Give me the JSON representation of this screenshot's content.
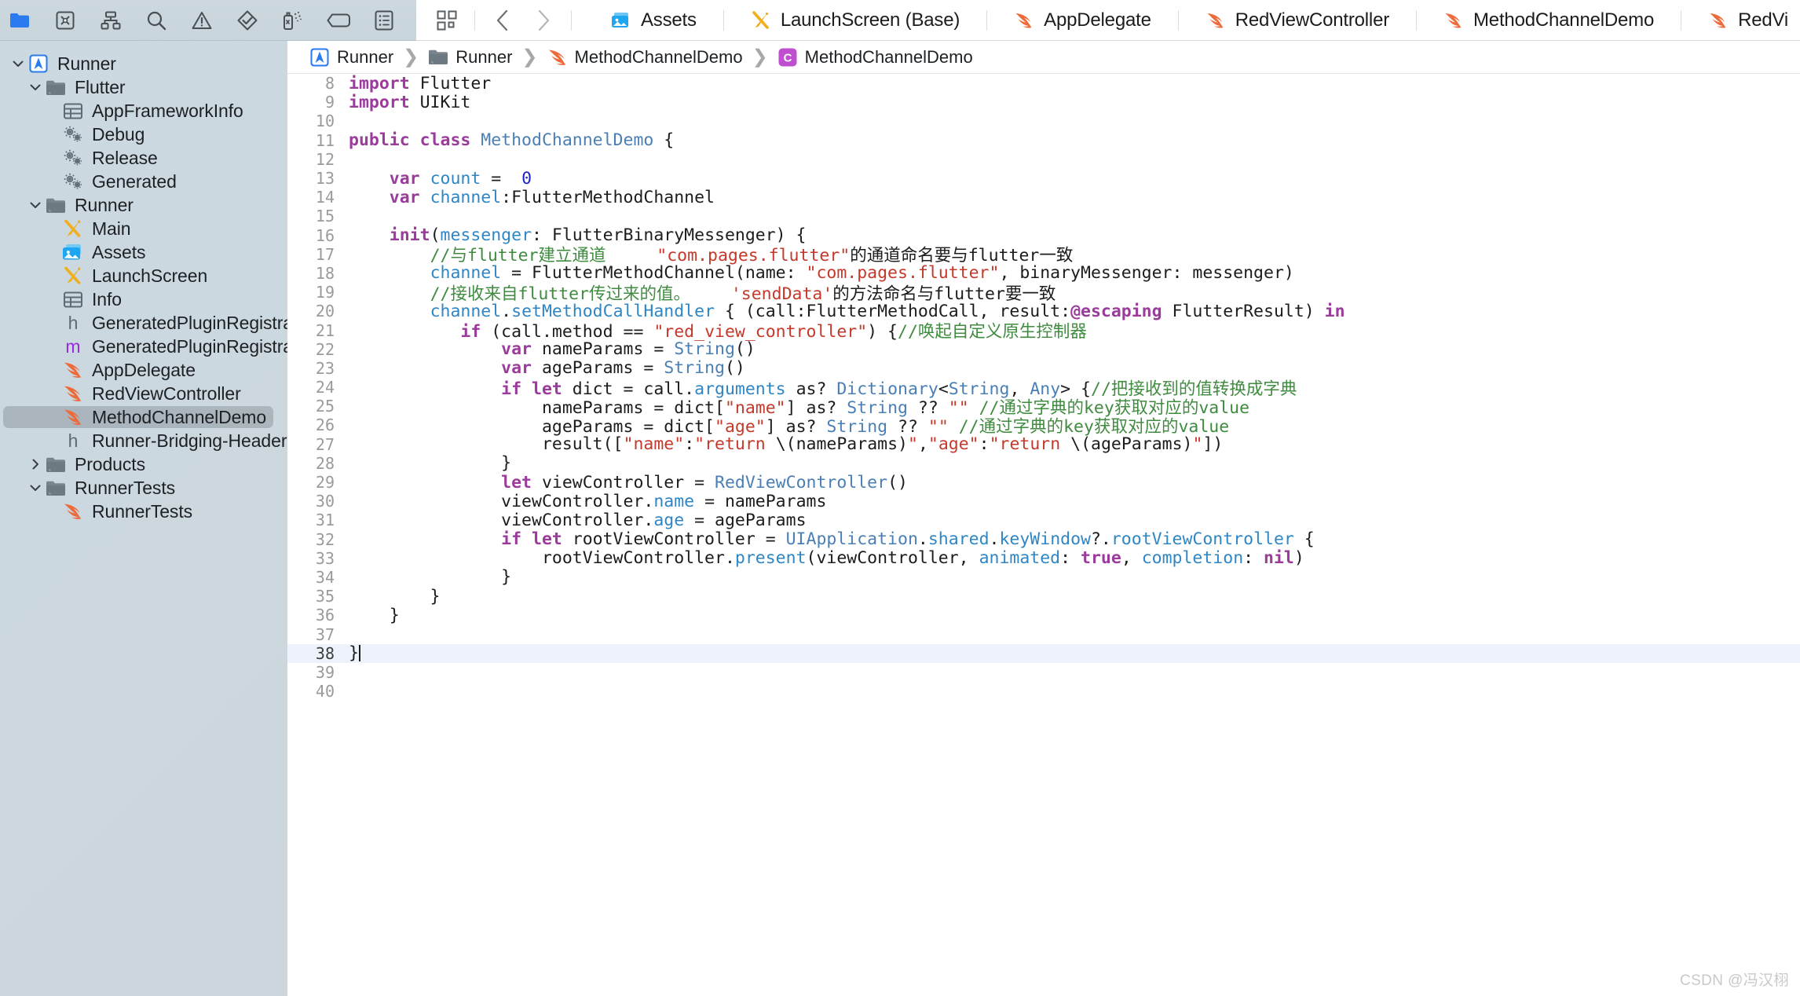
{
  "navigator_toolbar": {
    "icons": [
      {
        "name": "folder-icon",
        "label": "Project navigator"
      },
      {
        "name": "source-control-icon",
        "label": "Source control navigator"
      },
      {
        "name": "symbol-hierarchy-icon",
        "label": "Symbol navigator"
      },
      {
        "name": "search-icon",
        "label": "Find navigator"
      },
      {
        "name": "warning-triangle-icon",
        "label": "Issue navigator"
      },
      {
        "name": "test-diamond-icon",
        "label": "Test navigator"
      },
      {
        "name": "debug-spray-icon",
        "label": "Debug navigator"
      },
      {
        "name": "breakpoint-tag-icon",
        "label": "Breakpoint navigator"
      },
      {
        "name": "report-list-icon",
        "label": "Report navigator"
      }
    ]
  },
  "tabbar": {
    "grid_button": "tab-overview",
    "back_button": "back",
    "forward_button": "forward",
    "tabs": [
      {
        "label": "Assets",
        "icon": "assets-icon",
        "active": false
      },
      {
        "label": "LaunchScreen (Base)",
        "icon": "storyboard-icon",
        "active": false
      },
      {
        "label": "AppDelegate",
        "icon": "swift-icon",
        "active": false
      },
      {
        "label": "RedViewController",
        "icon": "swift-icon",
        "active": false
      },
      {
        "label": "MethodChannelDemo",
        "icon": "swift-icon",
        "active": true
      },
      {
        "label": "RedVi",
        "icon": "swift-icon",
        "active": false
      }
    ]
  },
  "sidebar": {
    "items": [
      {
        "label": "Runner",
        "indent": 0,
        "twisty": "down",
        "icon": "xcode-project-icon",
        "selected": false
      },
      {
        "label": "Flutter",
        "indent": 1,
        "twisty": "down",
        "icon": "folder-icon",
        "selected": false
      },
      {
        "label": "AppFrameworkInfo",
        "indent": 2,
        "twisty": "none",
        "icon": "plist-icon",
        "selected": false
      },
      {
        "label": "Debug",
        "indent": 2,
        "twisty": "none",
        "icon": "gears-icon",
        "selected": false
      },
      {
        "label": "Release",
        "indent": 2,
        "twisty": "none",
        "icon": "gears-icon",
        "selected": false
      },
      {
        "label": "Generated",
        "indent": 2,
        "twisty": "none",
        "icon": "gears-icon",
        "selected": false
      },
      {
        "label": "Runner",
        "indent": 1,
        "twisty": "down",
        "icon": "folder-icon",
        "selected": false
      },
      {
        "label": "Main",
        "indent": 2,
        "twisty": "none",
        "icon": "storyboard-icon",
        "selected": false
      },
      {
        "label": "Assets",
        "indent": 2,
        "twisty": "none",
        "icon": "assets-icon",
        "selected": false
      },
      {
        "label": "LaunchScreen",
        "indent": 2,
        "twisty": "none",
        "icon": "storyboard-icon",
        "selected": false
      },
      {
        "label": "Info",
        "indent": 2,
        "twisty": "none",
        "icon": "plist-icon",
        "selected": false
      },
      {
        "label": "GeneratedPluginRegistrant",
        "indent": 2,
        "twisty": "none",
        "icon": "header-h-icon",
        "selected": false
      },
      {
        "label": "GeneratedPluginRegistrant",
        "indent": 2,
        "twisty": "none",
        "icon": "objc-m-icon",
        "selected": false
      },
      {
        "label": "AppDelegate",
        "indent": 2,
        "twisty": "none",
        "icon": "swift-icon",
        "selected": false
      },
      {
        "label": "RedViewController",
        "indent": 2,
        "twisty": "none",
        "icon": "swift-icon",
        "selected": false
      },
      {
        "label": "MethodChannelDemo",
        "indent": 2,
        "twisty": "none",
        "icon": "swift-icon",
        "selected": true
      },
      {
        "label": "Runner-Bridging-Header",
        "indent": 2,
        "twisty": "none",
        "icon": "header-h-icon",
        "selected": false
      },
      {
        "label": "Products",
        "indent": 1,
        "twisty": "right",
        "icon": "folder-icon",
        "selected": false
      },
      {
        "label": "RunnerTests",
        "indent": 1,
        "twisty": "down",
        "icon": "folder-icon",
        "selected": false
      },
      {
        "label": "RunnerTests",
        "indent": 2,
        "twisty": "none",
        "icon": "swift-icon",
        "selected": false
      }
    ]
  },
  "breadcrumb": {
    "crumbs": [
      {
        "label": "Runner",
        "icon": "xcode-project-icon"
      },
      {
        "label": "Runner",
        "icon": "folder-icon"
      },
      {
        "label": "MethodChannelDemo",
        "icon": "swift-icon"
      },
      {
        "label": "MethodChannelDemo",
        "icon": "class-c-icon"
      }
    ],
    "separator": "❯"
  },
  "editor": {
    "first_line": 8,
    "current_line": 38,
    "lines": [
      {
        "n": 8,
        "tokens": [
          {
            "t": "import",
            "c": "kw"
          },
          {
            "t": " Flutter",
            "c": "plain"
          }
        ]
      },
      {
        "n": 9,
        "tokens": [
          {
            "t": "import",
            "c": "kw"
          },
          {
            "t": " UIKit",
            "c": "plain"
          }
        ]
      },
      {
        "n": 10,
        "tokens": []
      },
      {
        "n": 11,
        "tokens": [
          {
            "t": "public ",
            "c": "kw"
          },
          {
            "t": "class ",
            "c": "kw"
          },
          {
            "t": "MethodChannelDemo",
            "c": "ty"
          },
          {
            "t": " {",
            "c": "plain"
          }
        ]
      },
      {
        "n": 12,
        "tokens": []
      },
      {
        "n": 13,
        "tokens": [
          {
            "t": "    ",
            "c": "plain"
          },
          {
            "t": "var ",
            "c": "kw"
          },
          {
            "t": "count",
            "c": "id"
          },
          {
            "t": " =  ",
            "c": "plain"
          },
          {
            "t": "0",
            "c": "num"
          }
        ]
      },
      {
        "n": 14,
        "tokens": [
          {
            "t": "    ",
            "c": "plain"
          },
          {
            "t": "var ",
            "c": "kw"
          },
          {
            "t": "channel",
            "c": "id"
          },
          {
            "t": ":FlutterMethodChannel",
            "c": "plain"
          }
        ]
      },
      {
        "n": 15,
        "tokens": []
      },
      {
        "n": 16,
        "tokens": [
          {
            "t": "    ",
            "c": "plain"
          },
          {
            "t": "init",
            "c": "kw"
          },
          {
            "t": "(",
            "c": "plain"
          },
          {
            "t": "messenger",
            "c": "id"
          },
          {
            "t": ": FlutterBinaryMessenger) {",
            "c": "plain"
          }
        ]
      },
      {
        "n": 17,
        "tokens": [
          {
            "t": "        ",
            "c": "plain"
          },
          {
            "t": "//与flutter建立通道     ",
            "c": "cmt"
          },
          {
            "t": "\"com.pages.flutter\"",
            "c": "str"
          },
          {
            "t": "的通道命名要与flutter一致",
            "c": "plain"
          }
        ]
      },
      {
        "n": 18,
        "tokens": [
          {
            "t": "        ",
            "c": "plain"
          },
          {
            "t": "channel",
            "c": "id"
          },
          {
            "t": " = FlutterMethodChannel(name: ",
            "c": "plain"
          },
          {
            "t": "\"com.pages.flutter\"",
            "c": "str"
          },
          {
            "t": ", binaryMessenger: messenger)",
            "c": "plain"
          }
        ]
      },
      {
        "n": 19,
        "tokens": [
          {
            "t": "        ",
            "c": "plain"
          },
          {
            "t": "//接收来自flutter传过来的值。    ",
            "c": "cmt"
          },
          {
            "t": "'sendData'",
            "c": "str"
          },
          {
            "t": "的方法命名与flutter要一致",
            "c": "plain"
          }
        ]
      },
      {
        "n": 20,
        "tokens": [
          {
            "t": "        ",
            "c": "plain"
          },
          {
            "t": "channel",
            "c": "id"
          },
          {
            "t": ".",
            "c": "plain"
          },
          {
            "t": "setMethodCallHandler",
            "c": "prop"
          },
          {
            "t": " { (call:FlutterMethodCall, result:",
            "c": "plain"
          },
          {
            "t": "@escaping",
            "c": "attr"
          },
          {
            "t": " FlutterResult) ",
            "c": "plain"
          },
          {
            "t": "in",
            "c": "kw"
          }
        ]
      },
      {
        "n": 21,
        "tokens": [
          {
            "t": "           ",
            "c": "plain"
          },
          {
            "t": "if",
            "c": "kw"
          },
          {
            "t": " (call.method == ",
            "c": "plain"
          },
          {
            "t": "\"red_view_controller\"",
            "c": "str"
          },
          {
            "t": ") {",
            "c": "plain"
          },
          {
            "t": "//唤起自定义原生控制器",
            "c": "cmt"
          }
        ]
      },
      {
        "n": 22,
        "tokens": [
          {
            "t": "               ",
            "c": "plain"
          },
          {
            "t": "var ",
            "c": "kw"
          },
          {
            "t": "nameParams = ",
            "c": "plain"
          },
          {
            "t": "String",
            "c": "ty"
          },
          {
            "t": "()",
            "c": "plain"
          }
        ]
      },
      {
        "n": 23,
        "tokens": [
          {
            "t": "               ",
            "c": "plain"
          },
          {
            "t": "var ",
            "c": "kw"
          },
          {
            "t": "ageParams = ",
            "c": "plain"
          },
          {
            "t": "String",
            "c": "ty"
          },
          {
            "t": "()",
            "c": "plain"
          }
        ]
      },
      {
        "n": 24,
        "tokens": [
          {
            "t": "               ",
            "c": "plain"
          },
          {
            "t": "if let ",
            "c": "kw"
          },
          {
            "t": "dict = call.",
            "c": "plain"
          },
          {
            "t": "arguments",
            "c": "prop"
          },
          {
            "t": " as? ",
            "c": "plain"
          },
          {
            "t": "Dictionary",
            "c": "ty"
          },
          {
            "t": "<",
            "c": "plain"
          },
          {
            "t": "String",
            "c": "ty"
          },
          {
            "t": ", ",
            "c": "plain"
          },
          {
            "t": "Any",
            "c": "ty"
          },
          {
            "t": "> {",
            "c": "plain"
          },
          {
            "t": "//把接收到的值转换成字典",
            "c": "cmt"
          }
        ]
      },
      {
        "n": 25,
        "tokens": [
          {
            "t": "                   ",
            "c": "plain"
          },
          {
            "t": "nameParams = dict[",
            "c": "plain"
          },
          {
            "t": "\"name\"",
            "c": "str"
          },
          {
            "t": "] as? ",
            "c": "plain"
          },
          {
            "t": "String",
            "c": "ty"
          },
          {
            "t": " ?? ",
            "c": "plain"
          },
          {
            "t": "\"\"",
            "c": "str"
          },
          {
            "t": " ",
            "c": "plain"
          },
          {
            "t": "//通过字典的key获取对应的value",
            "c": "cmt"
          }
        ]
      },
      {
        "n": 26,
        "tokens": [
          {
            "t": "                   ",
            "c": "plain"
          },
          {
            "t": "ageParams = dict[",
            "c": "plain"
          },
          {
            "t": "\"age\"",
            "c": "str"
          },
          {
            "t": "] as? ",
            "c": "plain"
          },
          {
            "t": "String",
            "c": "ty"
          },
          {
            "t": " ?? ",
            "c": "plain"
          },
          {
            "t": "\"\"",
            "c": "str"
          },
          {
            "t": " ",
            "c": "plain"
          },
          {
            "t": "//通过字典的key获取对应的value",
            "c": "cmt"
          }
        ]
      },
      {
        "n": 27,
        "tokens": [
          {
            "t": "                   ",
            "c": "plain"
          },
          {
            "t": "result([",
            "c": "plain"
          },
          {
            "t": "\"name\"",
            "c": "str"
          },
          {
            "t": ":",
            "c": "plain"
          },
          {
            "t": "\"return ",
            "c": "str"
          },
          {
            "t": "\\(nameParams)",
            "c": "plain"
          },
          {
            "t": "\"",
            "c": "str"
          },
          {
            "t": ",",
            "c": "plain"
          },
          {
            "t": "\"age\"",
            "c": "str"
          },
          {
            "t": ":",
            "c": "plain"
          },
          {
            "t": "\"return ",
            "c": "str"
          },
          {
            "t": "\\(ageParams)",
            "c": "plain"
          },
          {
            "t": "\"",
            "c": "str"
          },
          {
            "t": "])",
            "c": "plain"
          }
        ]
      },
      {
        "n": 28,
        "tokens": [
          {
            "t": "               }",
            "c": "plain"
          }
        ]
      },
      {
        "n": 29,
        "tokens": [
          {
            "t": "               ",
            "c": "plain"
          },
          {
            "t": "let ",
            "c": "kw"
          },
          {
            "t": "viewController = ",
            "c": "plain"
          },
          {
            "t": "RedViewController",
            "c": "ty"
          },
          {
            "t": "()",
            "c": "plain"
          }
        ]
      },
      {
        "n": 30,
        "tokens": [
          {
            "t": "               ",
            "c": "plain"
          },
          {
            "t": "viewController.",
            "c": "plain"
          },
          {
            "t": "name",
            "c": "prop"
          },
          {
            "t": " = nameParams",
            "c": "plain"
          }
        ]
      },
      {
        "n": 31,
        "tokens": [
          {
            "t": "               ",
            "c": "plain"
          },
          {
            "t": "viewController.",
            "c": "plain"
          },
          {
            "t": "age",
            "c": "prop"
          },
          {
            "t": " = ageParams",
            "c": "plain"
          }
        ]
      },
      {
        "n": 32,
        "tokens": [
          {
            "t": "               ",
            "c": "plain"
          },
          {
            "t": "if let ",
            "c": "kw"
          },
          {
            "t": "rootViewController = ",
            "c": "plain"
          },
          {
            "t": "UIApplication",
            "c": "ty"
          },
          {
            "t": ".",
            "c": "plain"
          },
          {
            "t": "shared",
            "c": "prop"
          },
          {
            "t": ".",
            "c": "plain"
          },
          {
            "t": "keyWindow",
            "c": "prop"
          },
          {
            "t": "?.",
            "c": "plain"
          },
          {
            "t": "rootViewController",
            "c": "prop"
          },
          {
            "t": " {",
            "c": "plain"
          }
        ]
      },
      {
        "n": 33,
        "tokens": [
          {
            "t": "                   ",
            "c": "plain"
          },
          {
            "t": "rootViewController.",
            "c": "plain"
          },
          {
            "t": "present",
            "c": "prop"
          },
          {
            "t": "(viewController, ",
            "c": "plain"
          },
          {
            "t": "animated",
            "c": "prop"
          },
          {
            "t": ": ",
            "c": "plain"
          },
          {
            "t": "true",
            "c": "kw"
          },
          {
            "t": ", ",
            "c": "plain"
          },
          {
            "t": "completion",
            "c": "prop"
          },
          {
            "t": ": ",
            "c": "plain"
          },
          {
            "t": "nil",
            "c": "kw"
          },
          {
            "t": ")",
            "c": "plain"
          }
        ]
      },
      {
        "n": 34,
        "tokens": [
          {
            "t": "               }",
            "c": "plain"
          }
        ]
      },
      {
        "n": 35,
        "tokens": [
          {
            "t": "        }",
            "c": "plain"
          }
        ]
      },
      {
        "n": 36,
        "tokens": [
          {
            "t": "    }",
            "c": "plain"
          }
        ]
      },
      {
        "n": 37,
        "tokens": []
      },
      {
        "n": 38,
        "tokens": [
          {
            "t": "}",
            "c": "plain"
          }
        ],
        "caret": true
      },
      {
        "n": 39,
        "tokens": []
      },
      {
        "n": 40,
        "tokens": []
      }
    ]
  },
  "watermark": "CSDN @冯汉栩",
  "colors": {
    "swift_orange": "#ED6B3A",
    "storyboard_yellow": "#F0AF1E",
    "assets_blue": "#1EA7F0",
    "class_purple": "#BF4FD0",
    "project_blue": "#2A7BF0",
    "keyword_magenta": "#9B3B9B",
    "string_red": "#C5392B",
    "comment_green": "#3F8B3F",
    "type_blue": "#4A7FB5",
    "number_blue": "#1C24C9"
  }
}
